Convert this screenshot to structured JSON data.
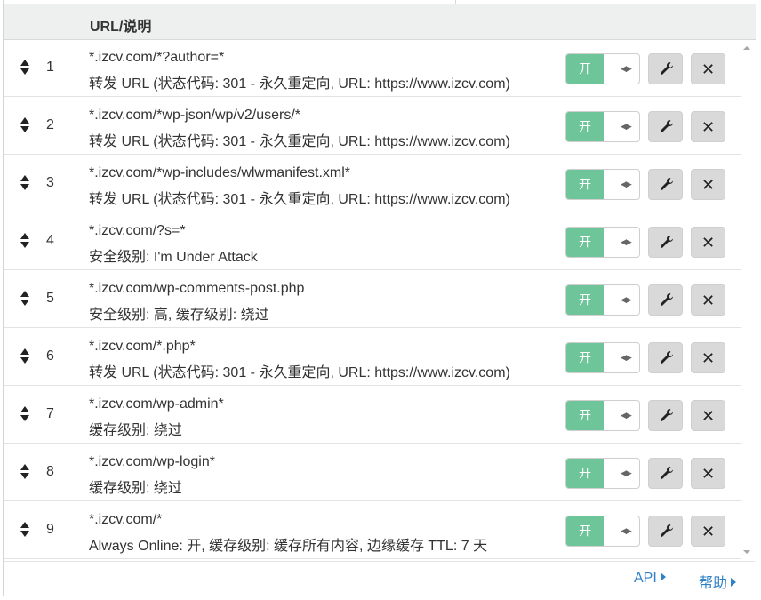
{
  "header": {
    "column_label": "URL/说明"
  },
  "rules": [
    {
      "index": "1",
      "url": "*.izcv.com/*?author=*",
      "description": "转发 URL (状态代码: 301 - 永久重定向, URL: https://www.izcv.com)",
      "toggle_label": "开"
    },
    {
      "index": "2",
      "url": "*.izcv.com/*wp-json/wp/v2/users/*",
      "description": "转发 URL (状态代码: 301 - 永久重定向, URL: https://www.izcv.com)",
      "toggle_label": "开"
    },
    {
      "index": "3",
      "url": "*.izcv.com/*wp-includes/wlwmanifest.xml*",
      "description": "转发 URL (状态代码: 301 - 永久重定向, URL: https://www.izcv.com)",
      "toggle_label": "开"
    },
    {
      "index": "4",
      "url": "*.izcv.com/?s=*",
      "description": "安全级别: I'm Under Attack",
      "toggle_label": "开"
    },
    {
      "index": "5",
      "url": "*.izcv.com/wp-comments-post.php",
      "description": "安全级别: 高, 缓存级别: 绕过",
      "toggle_label": "开"
    },
    {
      "index": "6",
      "url": "*.izcv.com/*.php*",
      "description": "转发 URL (状态代码: 301 - 永久重定向, URL: https://www.izcv.com)",
      "toggle_label": "开"
    },
    {
      "index": "7",
      "url": "*.izcv.com/wp-admin*",
      "description": "缓存级别: 绕过",
      "toggle_label": "开"
    },
    {
      "index": "8",
      "url": "*.izcv.com/wp-login*",
      "description": "缓存级别: 绕过",
      "toggle_label": "开"
    },
    {
      "index": "9",
      "url": "*.izcv.com/*",
      "description": "Always Online: 开, 缓存级别: 缓存所有内容, 边缘缓存 TTL: 7 天",
      "toggle_label": "开"
    }
  ],
  "footer": {
    "api_link": "API",
    "help_link": "帮助"
  },
  "colors": {
    "toggle_on": "#6fc59a",
    "link": "#2f82c6",
    "button_bg": "#d9d9d9"
  },
  "icons": {
    "drag": "sort-arrows-icon",
    "edit": "wrench-icon",
    "delete": "close-icon",
    "toggle_grip": "grip-icon"
  }
}
